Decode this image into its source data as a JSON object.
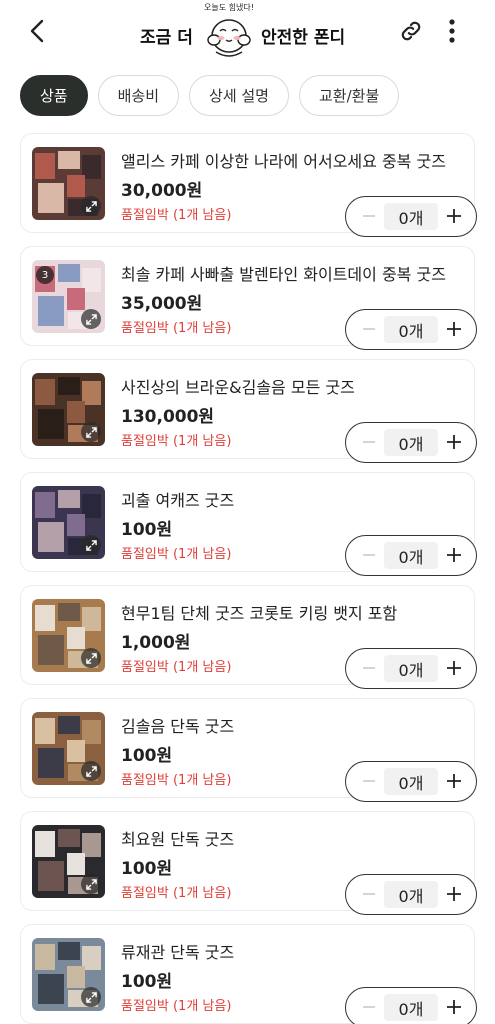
{
  "header": {
    "title_left": "조금 더",
    "title_right": "안전한 폰디",
    "mascot_text": "오늘도 힘냈다!",
    "icons": {
      "back": "back-arrow-icon",
      "link": "link-icon",
      "more": "more-vertical-icon"
    }
  },
  "tabs": [
    {
      "label": "상품",
      "active": true
    },
    {
      "label": "배송비",
      "active": false
    },
    {
      "label": "상세 설명",
      "active": false
    },
    {
      "label": "교환/환불",
      "active": false
    }
  ],
  "products": [
    {
      "name": "앨리스 카페 이상한 나라에 어서오세요 중복 굿즈",
      "price": "30,000원",
      "stock": "품절임박 (1개 남음)",
      "qty": "0개",
      "badge": "",
      "palette": [
        "#5b3b35",
        "#b05a4e",
        "#d9b8a8",
        "#3a2a2e"
      ]
    },
    {
      "name": "최솔 카페 사빠출 발렌타인 화이트데이 중복 굿즈",
      "price": "35,000원",
      "stock": "품절임박 (1개 남음)",
      "qty": "0개",
      "badge": "3",
      "palette": [
        "#e8d8dc",
        "#c76b7b",
        "#8a9bc2",
        "#f2e6e8"
      ]
    },
    {
      "name": "사진상의 브라운&김솔음 모든 굿즈",
      "price": "130,000원",
      "stock": "품절임박 (1개 남음)",
      "qty": "0개",
      "badge": "",
      "palette": [
        "#4a3226",
        "#8b5a40",
        "#2a1e18",
        "#b07b5a"
      ]
    },
    {
      "name": "괴출 여캐즈 굿즈",
      "price": "100원",
      "stock": "품절임박 (1개 남음)",
      "qty": "0개",
      "badge": "",
      "palette": [
        "#3c3550",
        "#7f6c8e",
        "#b3a0a8",
        "#29283a"
      ]
    },
    {
      "name": "현무1팀 단체 굿즈 코롯토 키링 뱃지 포함",
      "price": "1,000원",
      "stock": "품절임박 (1개 남음)",
      "qty": "0개",
      "badge": "",
      "palette": [
        "#a87b4e",
        "#e6dcd0",
        "#6f5a4a",
        "#cfb79a"
      ]
    },
    {
      "name": "김솔음 단독 굿즈",
      "price": "100원",
      "stock": "품절임박 (1개 남음)",
      "qty": "0개",
      "badge": "",
      "palette": [
        "#8a6040",
        "#d8c0a0",
        "#3b3b48",
        "#b08a60"
      ]
    },
    {
      "name": "최요원 단독 굿즈",
      "price": "100원",
      "stock": "품절임박 (1개 남음)",
      "qty": "0개",
      "badge": "",
      "palette": [
        "#2a2a2e",
        "#e8e2de",
        "#6c5450",
        "#a89890"
      ]
    },
    {
      "name": "류재관 단독 굿즈",
      "price": "100원",
      "stock": "품절임박 (1개 남음)",
      "qty": "0개",
      "badge": "",
      "palette": [
        "#7b8a9a",
        "#c9b8a0",
        "#3c4450",
        "#d8cfc0"
      ]
    }
  ],
  "colors": {
    "accent_dark": "#2b2f2c",
    "stock_warning": "#e0403a"
  }
}
